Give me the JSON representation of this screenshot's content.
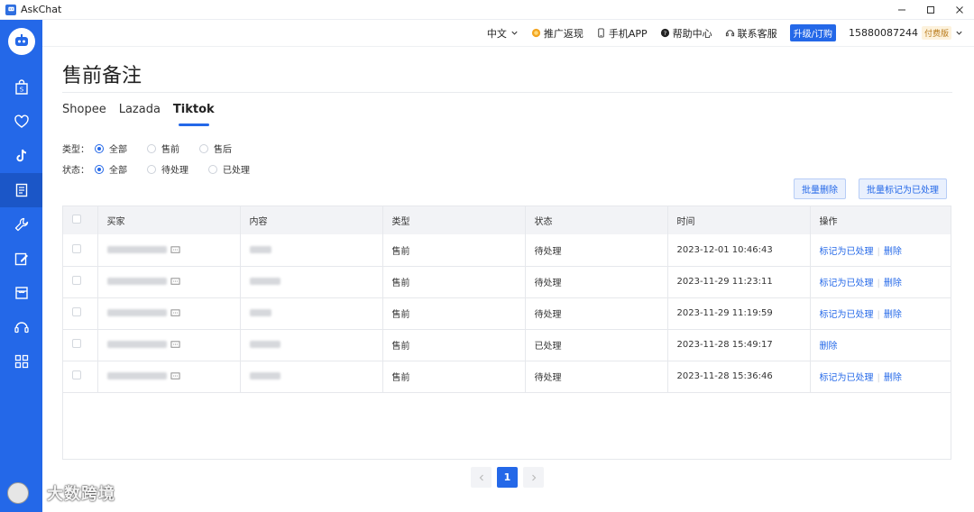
{
  "window": {
    "title": "AskChat",
    "controls": [
      "minimize-icon",
      "maximize-icon",
      "close-icon"
    ]
  },
  "sidebar": {
    "items": [
      {
        "icon": "shop-bag-icon",
        "name": "shopee"
      },
      {
        "icon": "heart-icon",
        "name": "lazada"
      },
      {
        "icon": "tiktok-icon",
        "name": "tiktok"
      },
      {
        "icon": "notes-icon",
        "name": "presale-notes",
        "active": true
      },
      {
        "icon": "wrench-icon",
        "name": "tools"
      },
      {
        "icon": "edit-icon",
        "name": "edit"
      },
      {
        "icon": "store-icon",
        "name": "store"
      },
      {
        "icon": "headset-icon",
        "name": "support"
      },
      {
        "icon": "grid-icon",
        "name": "apps"
      }
    ]
  },
  "topbar": {
    "language": "中文",
    "promo": "推广返现",
    "app": "手机APP",
    "help": "帮助中心",
    "service": "联系客服",
    "upgrade": "升级/订购",
    "phone": "15880087244",
    "plan": "付费版"
  },
  "page": {
    "title": "售前备注",
    "tabs": [
      {
        "label": "Shopee",
        "active": false
      },
      {
        "label": "Lazada",
        "active": false
      },
      {
        "label": "Tiktok",
        "active": true
      }
    ],
    "filters": {
      "type_label": "类型：",
      "type_options": [
        {
          "label": "全部",
          "selected": true
        },
        {
          "label": "售前",
          "selected": false
        },
        {
          "label": "售后",
          "selected": false
        }
      ],
      "status_label": "状态：",
      "status_options": [
        {
          "label": "全部",
          "selected": true
        },
        {
          "label": "待处理",
          "selected": false
        },
        {
          "label": "已处理",
          "selected": false
        }
      ]
    },
    "buttons": {
      "batch_delete": "批量删除",
      "batch_mark": "批量标记为已处理"
    },
    "table": {
      "headers": [
        "买家",
        "内容",
        "类型",
        "状态",
        "时间",
        "操作"
      ],
      "rows": [
        {
          "type": "售前",
          "status": "待处理",
          "time": "2023-12-01 10:46:43",
          "actions": [
            "标记为已处理",
            "删除"
          ]
        },
        {
          "type": "售前",
          "status": "待处理",
          "time": "2023-11-29 11:23:11",
          "actions": [
            "标记为已处理",
            "删除"
          ]
        },
        {
          "type": "售前",
          "status": "待处理",
          "time": "2023-11-29 11:19:59",
          "actions": [
            "标记为已处理",
            "删除"
          ]
        },
        {
          "type": "售前",
          "status": "已处理",
          "time": "2023-11-28 15:49:17",
          "actions": [
            "删除"
          ]
        },
        {
          "type": "售前",
          "status": "待处理",
          "time": "2023-11-28 15:36:46",
          "actions": [
            "标记为已处理",
            "删除"
          ]
        }
      ]
    },
    "pagination": {
      "current": "1"
    }
  },
  "watermark": {
    "text": "大数跨境"
  },
  "colors": {
    "accent": "#2468e8",
    "sidebar": "#2468e8",
    "header_bg": "#f2f3f6"
  }
}
